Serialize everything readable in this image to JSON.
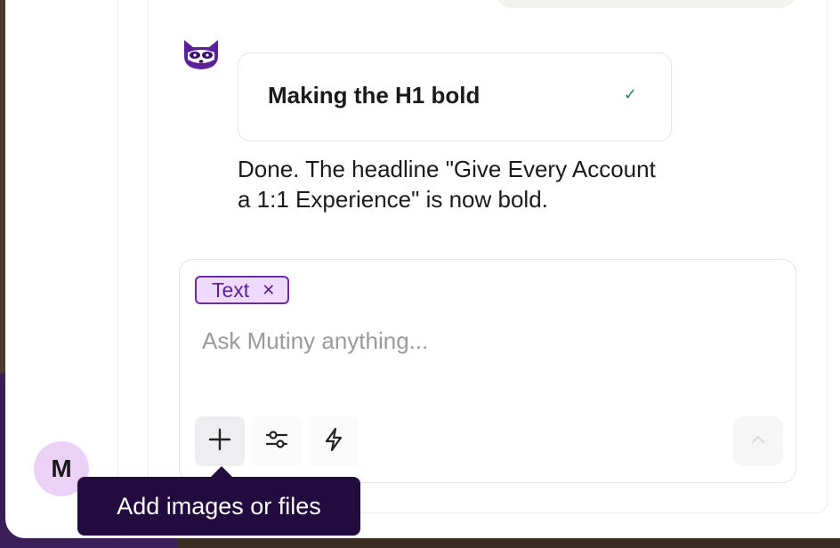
{
  "conversation": {
    "step": {
      "title": "Making the H1 bold",
      "status_icon": "check-icon",
      "status_color": "#2e8b57"
    },
    "assistant_reply": "Done. The headline \"Give Every Account a 1:1 Experience\" is now bold.",
    "assistant_avatar_icon": "raccoon-icon"
  },
  "composer": {
    "chip": {
      "label": "Text",
      "close_icon": "close-icon"
    },
    "placeholder": "Ask Mutiny anything...",
    "value": "",
    "tools": [
      {
        "icon": "plus-icon"
      },
      {
        "icon": "sliders-icon"
      },
      {
        "icon": "lightning-icon"
      }
    ],
    "send_icon": "chevron-up-icon"
  },
  "user": {
    "initial": "M"
  },
  "tooltip": {
    "text": "Add images or files"
  },
  "colors": {
    "accent": "#6a2aa8",
    "chip_bg": "#eedafc",
    "tooltip_bg": "#220b3e",
    "avatar_bg": "#ecd1f7"
  }
}
